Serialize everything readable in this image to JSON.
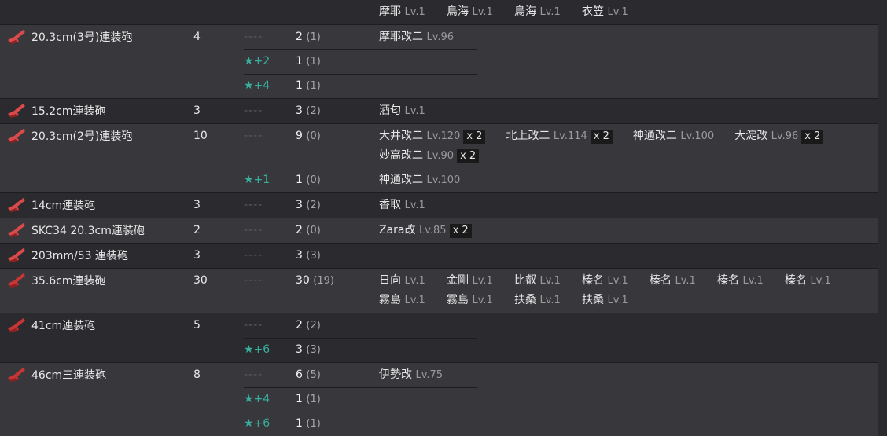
{
  "header_ships": [
    {
      "name": "摩耶",
      "lv": "Lv.1"
    },
    {
      "name": "鳥海",
      "lv": "Lv.1"
    },
    {
      "name": "鳥海",
      "lv": "Lv.1"
    },
    {
      "name": "衣笠",
      "lv": "Lv.1"
    }
  ],
  "rows": [
    {
      "name": "20.3cm(3号)連装砲",
      "total": "4",
      "gun_color": "#d94a4a",
      "subs": [
        {
          "level": "----",
          "count": "2",
          "paren": "(1)",
          "ships": [
            {
              "name": "摩耶改二",
              "lv": "Lv.96"
            }
          ]
        },
        {
          "level": "★+2",
          "count": "1",
          "paren": "(1)",
          "ships": []
        },
        {
          "level": "★+4",
          "count": "1",
          "paren": "(1)",
          "ships": []
        }
      ]
    },
    {
      "name": "15.2cm連装砲",
      "total": "3",
      "gun_color": "#d94a4a",
      "subs": [
        {
          "level": "----",
          "count": "3",
          "paren": "(2)",
          "ships": [
            {
              "name": "酒匂",
              "lv": "Lv.1"
            }
          ]
        }
      ]
    },
    {
      "name": "20.3cm(2号)連装砲",
      "total": "10",
      "gun_color": "#d94a4a",
      "subs": [
        {
          "level": "----",
          "count": "9",
          "paren": "(0)",
          "ships": [
            {
              "name": "大井改二",
              "lv": "Lv.120",
              "mul": "x 2"
            },
            {
              "name": "北上改二",
              "lv": "Lv.114",
              "mul": "x 2"
            },
            {
              "name": "神通改二",
              "lv": "Lv.100"
            },
            {
              "name": "大淀改",
              "lv": "Lv.96",
              "mul": "x 2"
            },
            {
              "name": "妙高改二",
              "lv": "Lv.90",
              "mul": "x 2"
            }
          ]
        },
        {
          "level": "★+1",
          "count": "1",
          "paren": "(0)",
          "ships": [
            {
              "name": "神通改二",
              "lv": "Lv.100"
            }
          ]
        }
      ]
    },
    {
      "name": "14cm連装砲",
      "total": "3",
      "gun_color": "#d94a4a",
      "subs": [
        {
          "level": "----",
          "count": "3",
          "paren": "(2)",
          "ships": [
            {
              "name": "香取",
              "lv": "Lv.1"
            }
          ]
        }
      ]
    },
    {
      "name": "SKC34 20.3cm連装砲",
      "total": "2",
      "gun_color": "#d94a4a",
      "subs": [
        {
          "level": "----",
          "count": "2",
          "paren": "(0)",
          "ships": [
            {
              "name": "Zara改",
              "lv": "Lv.85",
              "mul": "x 2"
            }
          ]
        }
      ]
    },
    {
      "name": "203mm/53 連装砲",
      "total": "3",
      "gun_color": "#d94a4a",
      "subs": [
        {
          "level": "----",
          "count": "3",
          "paren": "(3)",
          "ships": []
        }
      ]
    },
    {
      "name": "35.6cm連装砲",
      "total": "30",
      "gun_color": "#c93434",
      "subs": [
        {
          "level": "----",
          "count": "30",
          "paren": "(19)",
          "ships": [
            {
              "name": "日向",
              "lv": "Lv.1"
            },
            {
              "name": "金剛",
              "lv": "Lv.1"
            },
            {
              "name": "比叡",
              "lv": "Lv.1"
            },
            {
              "name": "榛名",
              "lv": "Lv.1"
            },
            {
              "name": "榛名",
              "lv": "Lv.1"
            },
            {
              "name": "榛名",
              "lv": "Lv.1"
            },
            {
              "name": "榛名",
              "lv": "Lv.1"
            },
            {
              "name": "霧島",
              "lv": "Lv.1"
            },
            {
              "name": "霧島",
              "lv": "Lv.1"
            },
            {
              "name": "扶桑",
              "lv": "Lv.1"
            },
            {
              "name": "扶桑",
              "lv": "Lv.1"
            }
          ]
        }
      ]
    },
    {
      "name": "41cm連装砲",
      "total": "5",
      "gun_color": "#c93434",
      "subs": [
        {
          "level": "----",
          "count": "2",
          "paren": "(2)",
          "ships": []
        },
        {
          "level": "★+6",
          "count": "3",
          "paren": "(3)",
          "ships": []
        }
      ]
    },
    {
      "name": "46cm三連装砲",
      "total": "8",
      "gun_color": "#c93434",
      "subs": [
        {
          "level": "----",
          "count": "6",
          "paren": "(5)",
          "ships": [
            {
              "name": "伊勢改",
              "lv": "Lv.75"
            }
          ]
        },
        {
          "level": "★+4",
          "count": "1",
          "paren": "(1)",
          "ships": []
        },
        {
          "level": "★+6",
          "count": "1",
          "paren": "(1)",
          "ships": []
        }
      ]
    }
  ]
}
